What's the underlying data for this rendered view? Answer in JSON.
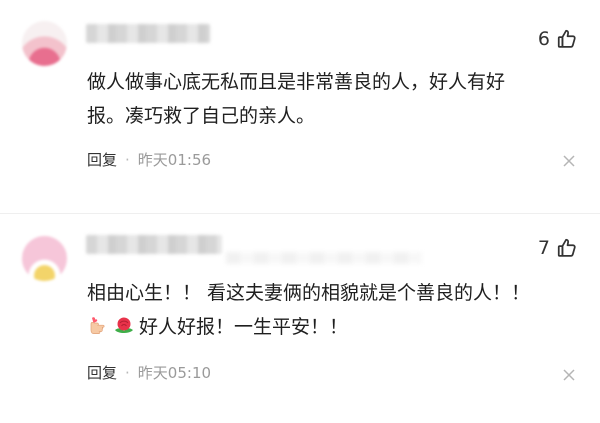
{
  "comments": [
    {
      "like_count": "6",
      "lines": [
        "做人做事心底无私而且是非常善良的人，好人有好",
        "报。凑巧救了自己的亲人。"
      ],
      "reply_label": "回复",
      "separator": "·",
      "time": "昨天01:56"
    },
    {
      "like_count": "7",
      "lines": [
        "相由心生！！ 看这夫妻俩的相貌就是个善良的人！！",
        "好人好报！一生平安！！"
      ],
      "emojis": [
        "finger-heart-hand-icon",
        "rose-icon"
      ],
      "reply_label": "回复",
      "separator": "·",
      "time": "昨天05:10"
    }
  ],
  "colors": {
    "text": "#1f1f1f",
    "meta": "#9a9a9a",
    "reply": "#333333",
    "divider": "#efefef"
  }
}
